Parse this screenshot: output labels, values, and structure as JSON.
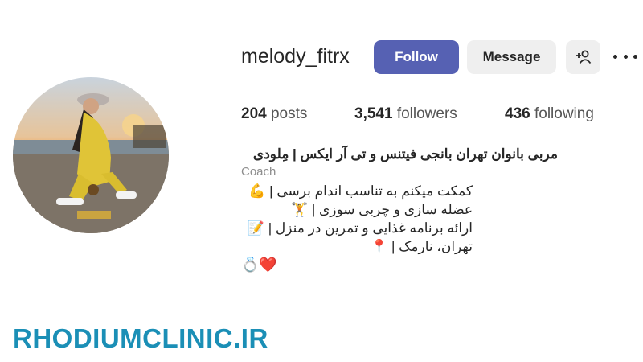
{
  "profile": {
    "username": "melody_fitrx",
    "avatar_icon": "profile-photo"
  },
  "actions": {
    "follow_label": "Follow",
    "message_label": "Message",
    "add_user_icon": "add-user-icon",
    "more_icon": "more-options-icon",
    "follow_color": "#5661b3"
  },
  "stats": {
    "posts_count": "204",
    "posts_label": "posts",
    "followers_count": "3,541",
    "followers_label": "followers",
    "following_count": "436",
    "following_label": "following"
  },
  "bio": {
    "name": "مربی بانوان تهران بانجی فیتنس و تی آر ایکس | مِلودی",
    "category": "Coach",
    "lines": [
      "کمکت میکنم به تناسب اندام برسی | 💪",
      "عضله سازی و چربی سوزی | 🏋",
      "ارائه برنامه غذایی و تمرین در منزل | 📝",
      "تهران، نارمک | 📍"
    ],
    "emoji_row": "💍❤️"
  },
  "watermark": "RHODIUMCLINIC.IR"
}
